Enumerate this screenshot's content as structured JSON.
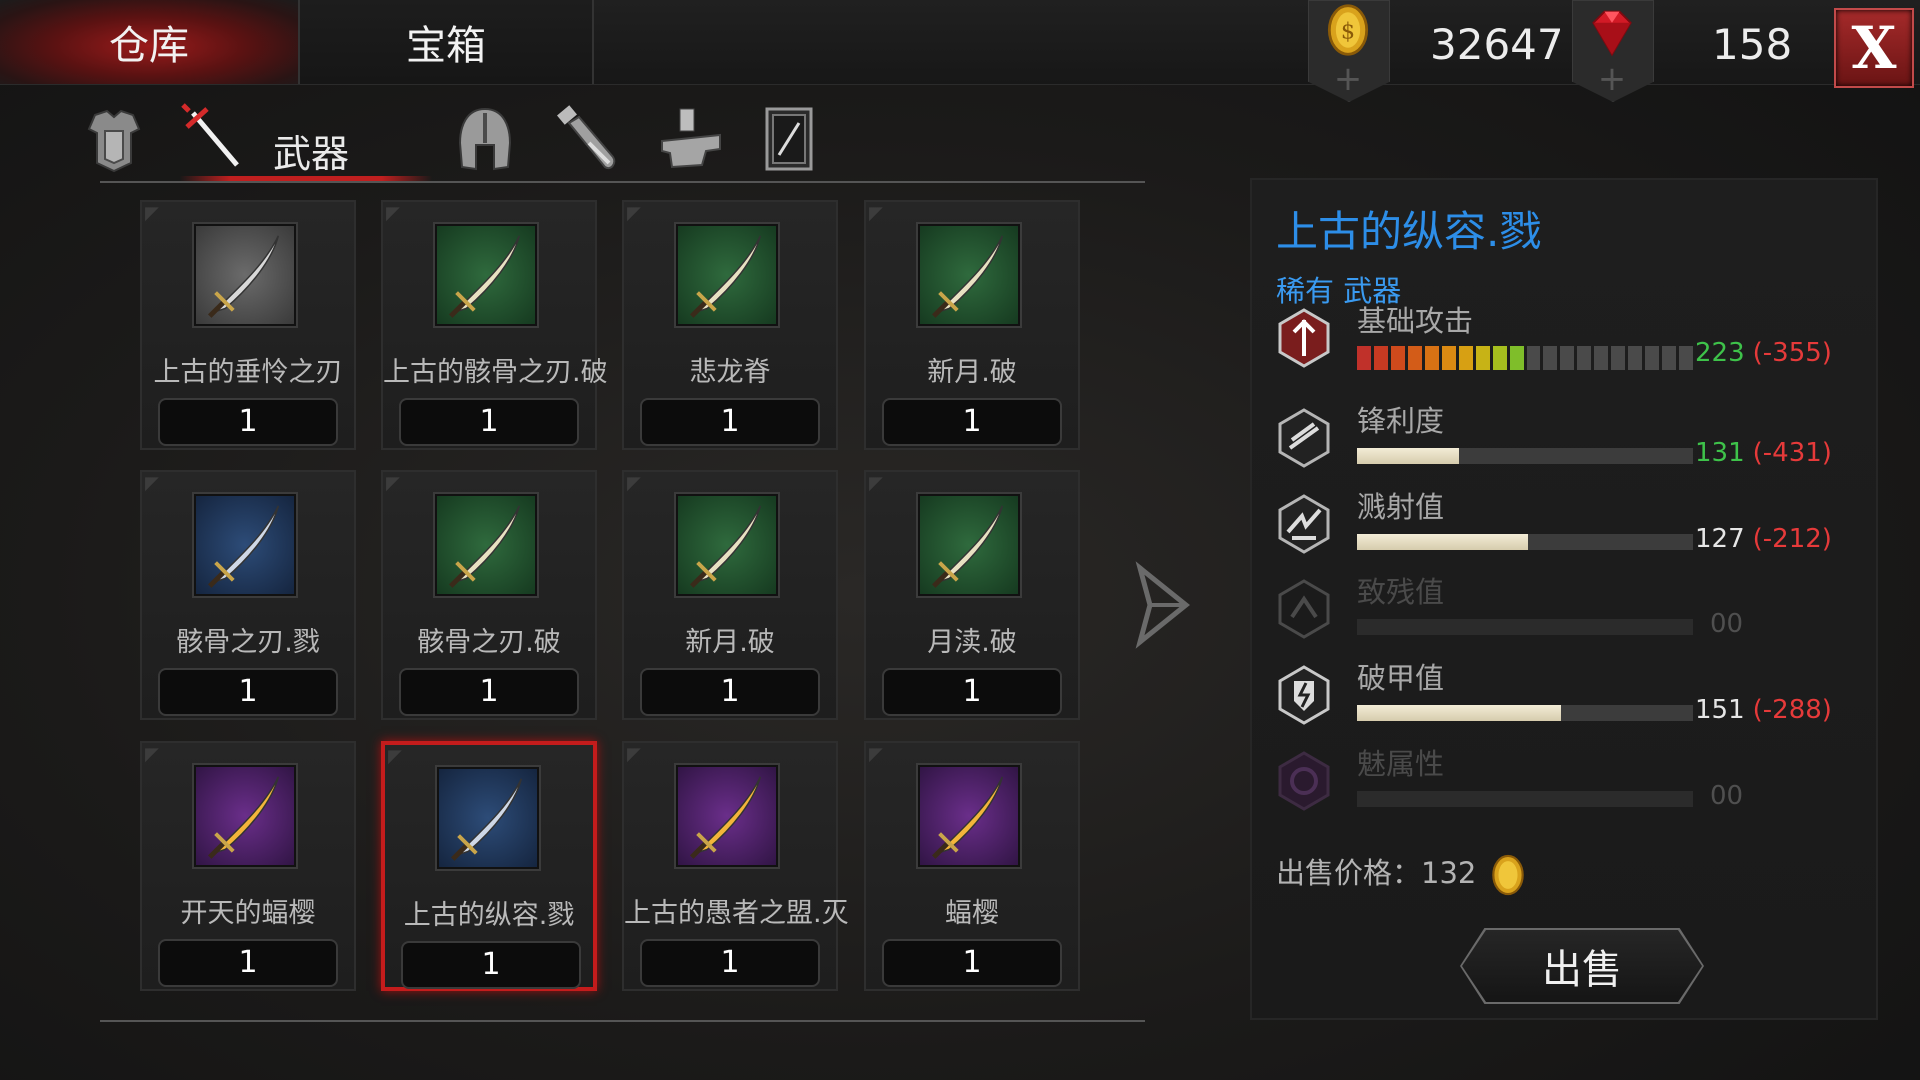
{
  "tabs": {
    "warehouse": "仓库",
    "chest": "宝箱"
  },
  "currency": {
    "gold": "32647",
    "gems": "158",
    "gold_icon": "gold-coin-icon",
    "gem_icon": "red-gem-icon"
  },
  "close_label": "X",
  "categories": {
    "active_label": "武器",
    "icons": [
      "armor-icon",
      "weapon-sword-icon",
      "helmet-icon",
      "potion-icon",
      "material-anvil-icon",
      "card-icon"
    ]
  },
  "items": [
    {
      "name": "上古的垂怜之刃",
      "qty": "1",
      "rarity_color": "gray"
    },
    {
      "name": "上古的骸骨之刃.破",
      "qty": "1",
      "rarity_color": "green"
    },
    {
      "name": "悲龙脊",
      "qty": "1",
      "rarity_color": "green"
    },
    {
      "name": "新月.破",
      "qty": "1",
      "rarity_color": "green"
    },
    {
      "name": "骸骨之刃.戮",
      "qty": "1",
      "rarity_color": "blue"
    },
    {
      "name": "骸骨之刃.破",
      "qty": "1",
      "rarity_color": "green"
    },
    {
      "name": "新月.破",
      "qty": "1",
      "rarity_color": "green"
    },
    {
      "name": "月渎.破",
      "qty": "1",
      "rarity_color": "green"
    },
    {
      "name": "开天的蝠樱",
      "qty": "1",
      "rarity_color": "purple"
    },
    {
      "name": "上古的纵容.戮",
      "qty": "1",
      "rarity_color": "blue",
      "selected": true
    },
    {
      "name": "上古的愚者之盟.灭",
      "qty": "1",
      "rarity_color": "purple"
    },
    {
      "name": "蝠樱",
      "qty": "1",
      "rarity_color": "purple"
    }
  ],
  "detail": {
    "title": "上古的纵容.戮",
    "rarity": "稀有 武器",
    "stats": [
      {
        "label": "基础攻击",
        "value": "223",
        "max": "(-355)",
        "fill": 0.628,
        "icon": "base-attack-icon"
      },
      {
        "label": "锋利度",
        "value": "131",
        "max": "(-431)",
        "fill": 0.304,
        "icon": "sharpness-icon"
      },
      {
        "label": "溅射值",
        "value": "127",
        "max": "(-212)",
        "fill": 0.509,
        "icon": "splash-icon"
      },
      {
        "label": "致残值",
        "value": "00",
        "fill": 0,
        "icon": "cripple-icon",
        "disabled": true
      },
      {
        "label": "破甲值",
        "value": "151",
        "max": "(-288)",
        "fill": 0.607,
        "icon": "armor-break-icon"
      },
      {
        "label": "魅属性",
        "value": "00",
        "fill": 0,
        "icon": "charm-icon",
        "disabled": true
      }
    ],
    "sell_price": "出售价格：132",
    "sell_button": "出售"
  },
  "colors": {
    "accent_red": "#c41c1c",
    "title_blue": "#2d8ee8",
    "positive_green": "#3ec24a",
    "negative_red": "#e63a3a"
  }
}
